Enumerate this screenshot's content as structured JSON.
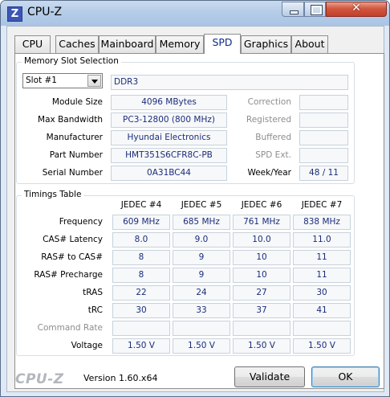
{
  "window": {
    "title": "CPU-Z",
    "icon_letter": "Z",
    "close_glyph": "✕"
  },
  "tabs": [
    {
      "label": "CPU"
    },
    {
      "label": "Caches"
    },
    {
      "label": "Mainboard"
    },
    {
      "label": "Memory"
    },
    {
      "label": "SPD",
      "active": true
    },
    {
      "label": "Graphics"
    },
    {
      "label": "About"
    }
  ],
  "slot_group": {
    "title": "Memory Slot Selection",
    "slot_select": "Slot #1",
    "type": "DDR3",
    "labels": {
      "module_size": "Module Size",
      "max_bandwidth": "Max Bandwidth",
      "manufacturer": "Manufacturer",
      "part_number": "Part Number",
      "serial_number": "Serial Number",
      "correction": "Correction",
      "registered": "Registered",
      "buffered": "Buffered",
      "spd_ext": "SPD Ext.",
      "week_year": "Week/Year"
    },
    "values": {
      "module_size": "4096 MBytes",
      "max_bandwidth": "PC3-12800 (800 MHz)",
      "manufacturer": "Hyundai Electronics",
      "part_number": "HMT351S6CFR8C-PB",
      "serial_number": "0A31BC44",
      "correction": "",
      "registered": "",
      "buffered": "",
      "spd_ext": "",
      "week_year": "48 / 11"
    }
  },
  "timings": {
    "title": "Timings Table",
    "columns": [
      "JEDEC #4",
      "JEDEC #5",
      "JEDEC #6",
      "JEDEC #7"
    ],
    "rows": [
      {
        "label": "Frequency",
        "values": [
          "609 MHz",
          "685 MHz",
          "761 MHz",
          "838 MHz"
        ]
      },
      {
        "label": "CAS# Latency",
        "values": [
          "8.0",
          "9.0",
          "10.0",
          "11.0"
        ]
      },
      {
        "label": "RAS# to CAS#",
        "values": [
          "8",
          "9",
          "10",
          "11"
        ]
      },
      {
        "label": "RAS# Precharge",
        "values": [
          "8",
          "9",
          "10",
          "11"
        ]
      },
      {
        "label": "tRAS",
        "values": [
          "22",
          "24",
          "27",
          "30"
        ]
      },
      {
        "label": "tRC",
        "values": [
          "30",
          "33",
          "37",
          "41"
        ]
      },
      {
        "label": "Command Rate",
        "values": [
          "",
          "",
          "",
          ""
        ],
        "disabled": true
      },
      {
        "label": "Voltage",
        "values": [
          "1.50 V",
          "1.50 V",
          "1.50 V",
          "1.50 V"
        ]
      }
    ]
  },
  "footer": {
    "brand": "CPU-Z",
    "version": "Version 1.60.x64",
    "validate_label": "Validate",
    "ok_label": "OK"
  }
}
